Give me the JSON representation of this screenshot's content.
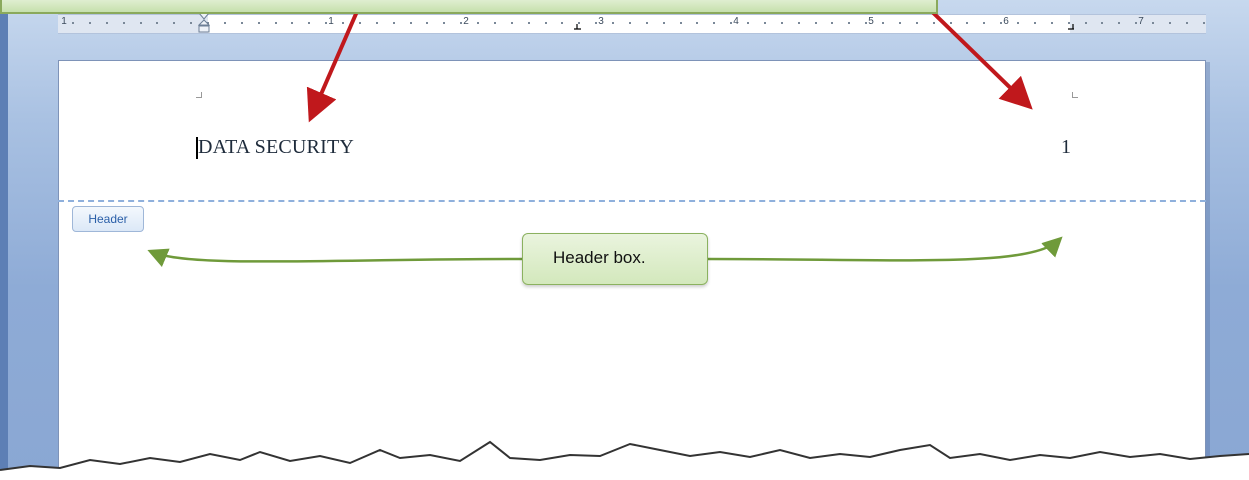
{
  "ruler": {
    "numbers": [
      "1",
      "1",
      "2",
      "3",
      "4",
      "5",
      "6",
      "7"
    ]
  },
  "document": {
    "header_text": "DATA SECURITY",
    "page_number": "1",
    "header_tag_label": "Header"
  },
  "callout": {
    "label": "Header box."
  },
  "colors": {
    "pointer_arrow": "#c0181c",
    "bracket_arrow": "#6f9a3a",
    "header_dashed_line": "#8fb0dc",
    "callout_fill": "#d3e8bc"
  }
}
